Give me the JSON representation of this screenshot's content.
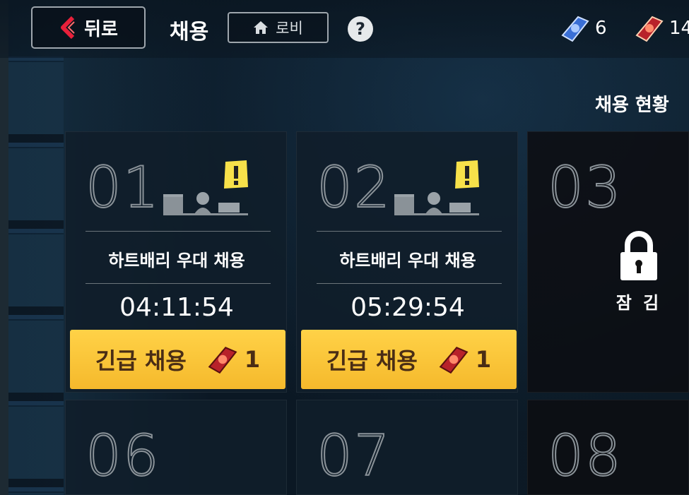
{
  "header": {
    "back_label": "뒤로",
    "title": "채용",
    "lobby_label": "로비",
    "help_label": "?"
  },
  "currencies": [
    {
      "icon": "blue-book-icon",
      "amount": "6"
    },
    {
      "icon": "red-book-icon",
      "amount": "14"
    }
  ],
  "status_title": "채용 현황",
  "slots": [
    {
      "number": "01",
      "name": "하트배리 우대 채용",
      "timer": "04:11:54",
      "button_label": "긴급 채용",
      "cost": "1"
    },
    {
      "number": "02",
      "name": "하트배리 우대 채용",
      "timer": "05:29:54",
      "button_label": "긴급 채용",
      "cost": "1"
    },
    {
      "number": "03",
      "lock_label": "잠 김"
    },
    {
      "number": "06"
    },
    {
      "number": "07"
    },
    {
      "number": "08"
    }
  ],
  "colors": {
    "accent": "#f5b92c",
    "panel": "#101e2a"
  }
}
